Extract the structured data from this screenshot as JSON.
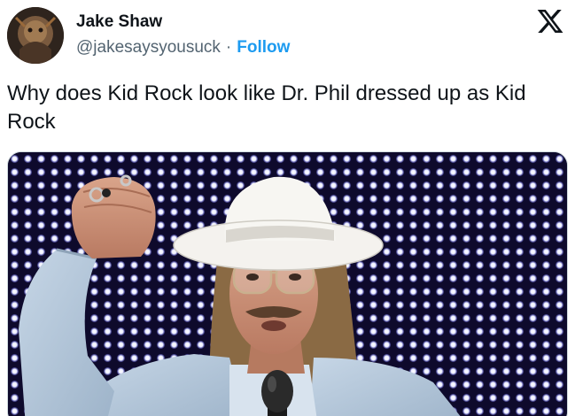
{
  "author": {
    "name": "Jake Shaw",
    "handle": "@jakesaysyousuck",
    "separator": "·",
    "follow_label": "Follow",
    "avatar_icon": "profile-avatar"
  },
  "platform": {
    "logo_icon": "x-logo-icon"
  },
  "post": {
    "text": "Why does Kid Rock look like Dr. Phil dressed up as Kid Rock"
  },
  "media": {
    "image_icon": "photo-man-white-fedora-raised-fist"
  },
  "colors": {
    "text_primary": "#0f1419",
    "text_secondary": "#536471",
    "link_blue": "#1d9bf0",
    "border": "#cfd9de"
  }
}
